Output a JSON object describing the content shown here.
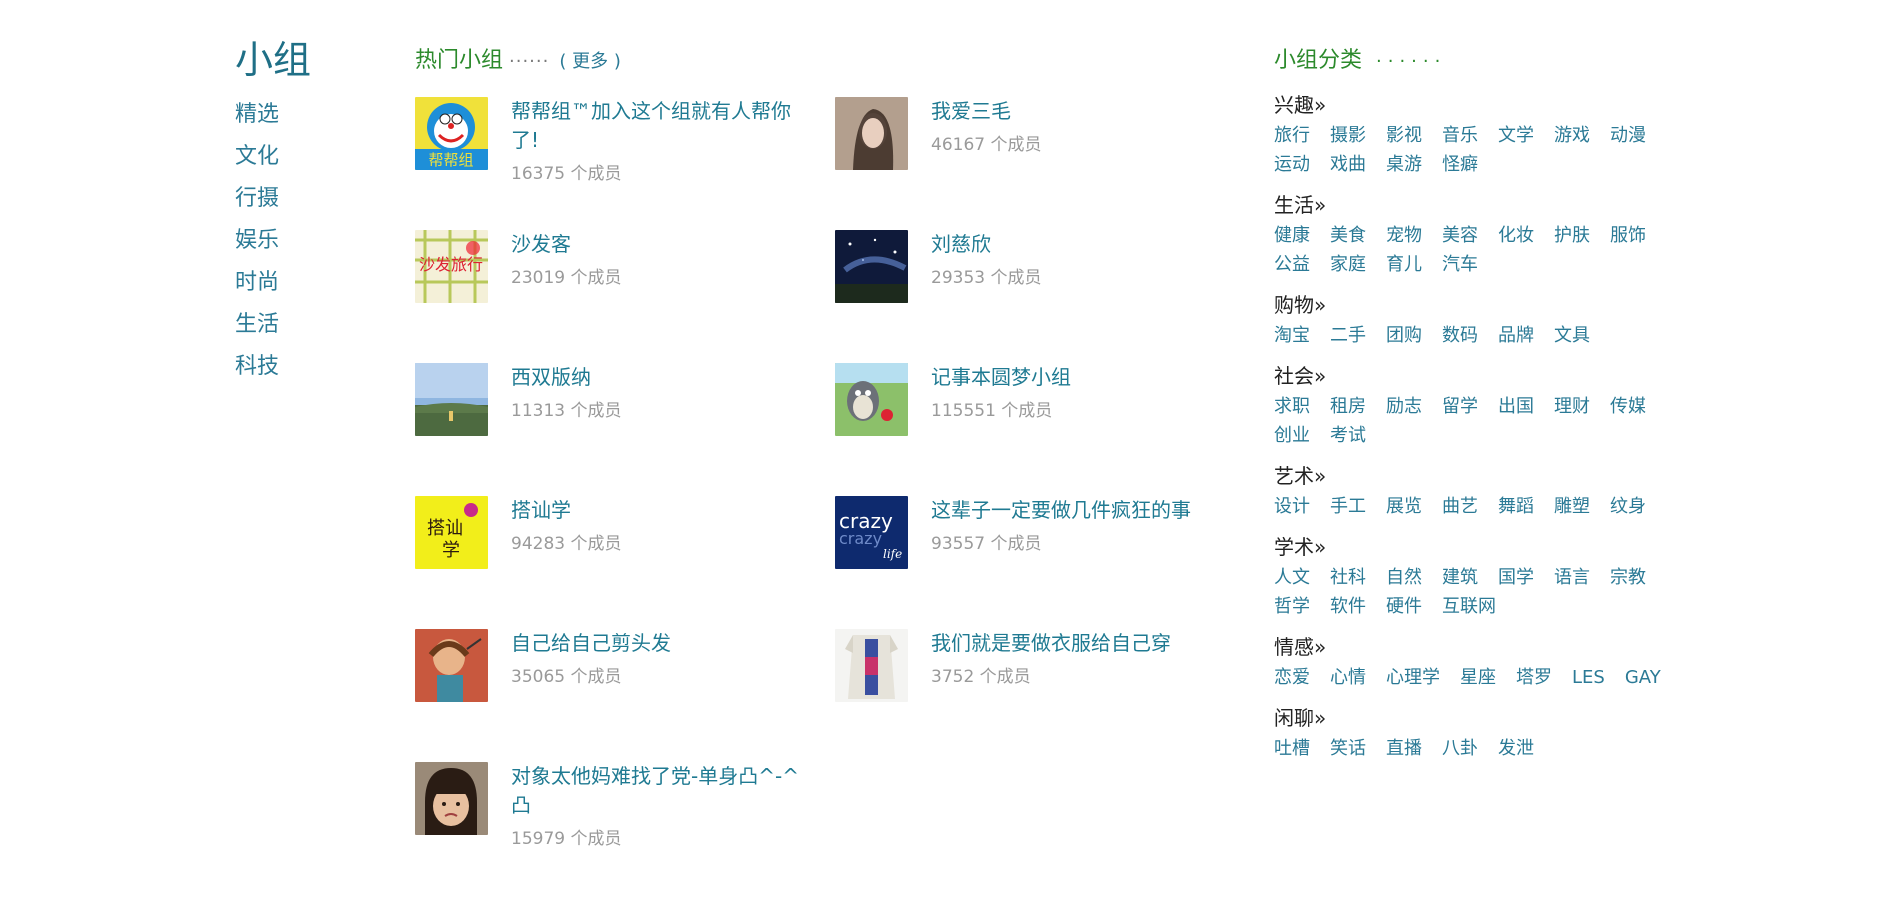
{
  "nav": {
    "title": "小组",
    "items": [
      "精选",
      "文化",
      "行摄",
      "娱乐",
      "时尚",
      "生活",
      "科技"
    ]
  },
  "hot": {
    "title": "热门小组",
    "dots": "······",
    "more": "( 更多 )",
    "groups": [
      {
        "name": "帮帮组™加入这个组就有人帮你了!",
        "count": "16375 个成员",
        "thumb": "doraemon-thumb"
      },
      {
        "name": "我爱三毛",
        "count": "46167 个成员",
        "thumb": "portrait-thumb"
      },
      {
        "name": "沙发客",
        "count": "23019 个成员",
        "thumb": "sofa-book-thumb"
      },
      {
        "name": "刘慈欣",
        "count": "29353 个成员",
        "thumb": "starry-night-thumb"
      },
      {
        "name": "西双版纳",
        "count": "11313 个成员",
        "thumb": "landscape-thumb"
      },
      {
        "name": "记事本圆梦小组",
        "count": "115551 个成员",
        "thumb": "totoro-thumb"
      },
      {
        "name": "搭讪学",
        "count": "94283 个成员",
        "thumb": "yellow-book-thumb"
      },
      {
        "name": "这辈子一定要做几件疯狂的事",
        "count": "93557 个成员",
        "thumb": "crazy-life-thumb"
      },
      {
        "name": "自己给自己剪头发",
        "count": "35065 个成员",
        "thumb": "haircut-thumb"
      },
      {
        "name": "我们就是要做衣服给自己穿",
        "count": "3752 个成员",
        "thumb": "clothes-thumb"
      },
      {
        "name": "对象太他妈难找了党-单身凸^-^凸",
        "count": "15979 个成员",
        "thumb": "girl-thumb"
      }
    ]
  },
  "cats": {
    "title": "小组分类",
    "dots": "······",
    "sections": [
      {
        "title": "兴趣»",
        "tags": [
          "旅行",
          "摄影",
          "影视",
          "音乐",
          "文学",
          "游戏",
          "动漫",
          "运动",
          "戏曲",
          "桌游",
          "怪癖"
        ]
      },
      {
        "title": "生活»",
        "tags": [
          "健康",
          "美食",
          "宠物",
          "美容",
          "化妆",
          "护肤",
          "服饰",
          "公益",
          "家庭",
          "育儿",
          "汽车"
        ]
      },
      {
        "title": "购物»",
        "tags": [
          "淘宝",
          "二手",
          "团购",
          "数码",
          "品牌",
          "文具"
        ]
      },
      {
        "title": "社会»",
        "tags": [
          "求职",
          "租房",
          "励志",
          "留学",
          "出国",
          "理财",
          "传媒",
          "创业",
          "考试"
        ]
      },
      {
        "title": "艺术»",
        "tags": [
          "设计",
          "手工",
          "展览",
          "曲艺",
          "舞蹈",
          "雕塑",
          "纹身"
        ]
      },
      {
        "title": "学术»",
        "tags": [
          "人文",
          "社科",
          "自然",
          "建筑",
          "国学",
          "语言",
          "宗教",
          "哲学",
          "软件",
          "硬件",
          "互联网"
        ]
      },
      {
        "title": "情感»",
        "tags": [
          "恋爱",
          "心情",
          "心理学",
          "星座",
          "塔罗",
          "LES",
          "GAY"
        ]
      },
      {
        "title": "闲聊»",
        "tags": [
          "吐槽",
          "笑话",
          "直播",
          "八卦",
          "发泄"
        ]
      }
    ]
  }
}
